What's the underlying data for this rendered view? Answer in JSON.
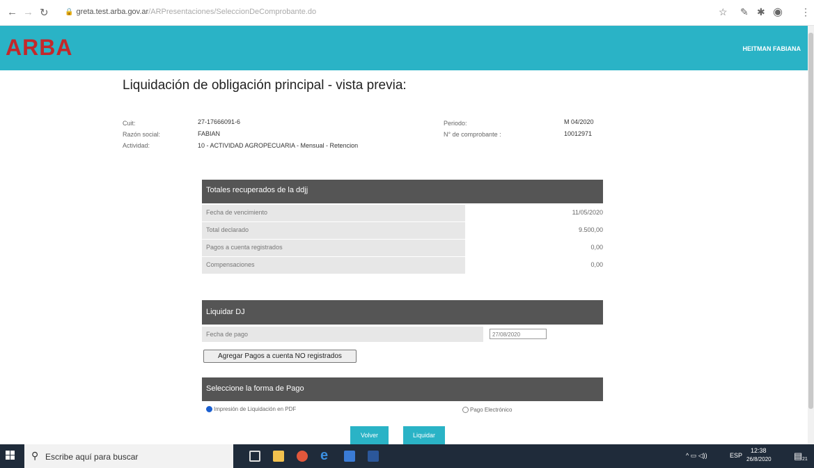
{
  "browser": {
    "url_host": "greta.test.arba.gov.ar",
    "url_path": "/ARPresentaciones/SeleccionDeComprobante.do"
  },
  "header": {
    "logo": "ARBA",
    "user_name": "HEITMAN FABIANA"
  },
  "page": {
    "title": "Liquidación de obligación principal - vista previa:"
  },
  "info": {
    "cuit_label": "Cuit:",
    "cuit_value": "27-17666091-6",
    "razon_label": "Razón social:",
    "razon_value": "FABIAN",
    "actividad_label": "Actividad:",
    "actividad_value": "10 - ACTIVIDAD AGROPECUARIA - Mensual - Retencion",
    "periodo_label": "Periodo:",
    "periodo_value": "M 04/2020",
    "comprobante_label": "N° de comprobante :",
    "comprobante_value": "10012971"
  },
  "totales": {
    "title": "Totales recuperados de la ddjj",
    "rows": [
      {
        "label": "Fecha de vencimiento",
        "value": "11/05/2020"
      },
      {
        "label": "Total declarado",
        "value": "9.500,00"
      },
      {
        "label": "Pagos a cuenta registrados",
        "value": "0,00"
      },
      {
        "label": "Compensaciones",
        "value": "0,00"
      }
    ]
  },
  "liquidar": {
    "title": "Liquidar DJ",
    "fecha_label": "Fecha de pago",
    "fecha_value": "27/08/2020",
    "agregar_button": "Agregar Pagos a cuenta NO registrados"
  },
  "forma_pago": {
    "title": "Seleccione la forma de Pago",
    "option_pdf": "Impresión de Liquidación en PDF",
    "option_electronico": "Pago Electrónico",
    "selected": "pdf"
  },
  "actions": {
    "volver": "Volver",
    "liquidar": "Liquidar"
  },
  "taskbar": {
    "search_placeholder": "Escribe aquí para buscar",
    "lang": "ESP",
    "time": "12:38",
    "date": "26/8/2020",
    "notification_count": "21"
  },
  "colors": {
    "header_bg": "#2ab3c6",
    "logo": "#c3282b",
    "panel_head": "#555555",
    "taskbar": "#1f2b3a"
  }
}
